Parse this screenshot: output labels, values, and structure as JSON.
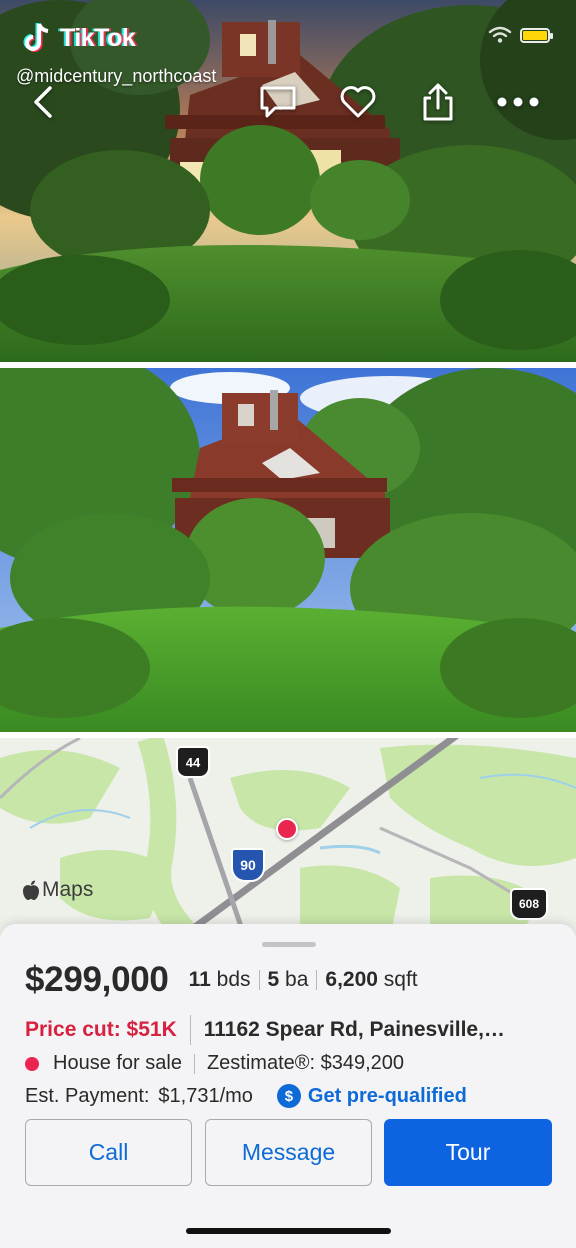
{
  "tiktok": {
    "logo_text": "TikTok",
    "handle": "@midcentury_northcoast"
  },
  "status_bar": {
    "icons": [
      "wifi-icon",
      "battery-icon"
    ],
    "battery_color": "#ffd60a"
  },
  "top_bar": {
    "icons": [
      "back-chevron-icon",
      "chat-icon",
      "heart-icon",
      "share-icon",
      "more-dots-icon"
    ]
  },
  "map": {
    "brand": "Maps",
    "route_labels": [
      "44",
      "90",
      "608"
    ],
    "pin_color": "#e8264e"
  },
  "listing": {
    "price": "$299,000",
    "beds_num": "11",
    "beds_unit": "bds",
    "baths_num": "5",
    "baths_unit": "ba",
    "sqft_num": "6,200",
    "sqft_unit": "sqft",
    "price_cut": "Price cut: $51K",
    "address": "11162 Spear Rd, Painesville,…",
    "status": "House for sale",
    "zestimate": "Zestimate®: $349,200",
    "est_payment_label": "Est. Payment:",
    "est_payment_value": "$1,731/mo",
    "prequal_symbol": "$",
    "prequal_label": "Get pre-qualified"
  },
  "actions": {
    "call": "Call",
    "message": "Message",
    "tour": "Tour"
  },
  "colors": {
    "accent_blue": "#0d63e0",
    "price_cut_red": "#d6213f",
    "status_dot": "#e8264e"
  }
}
